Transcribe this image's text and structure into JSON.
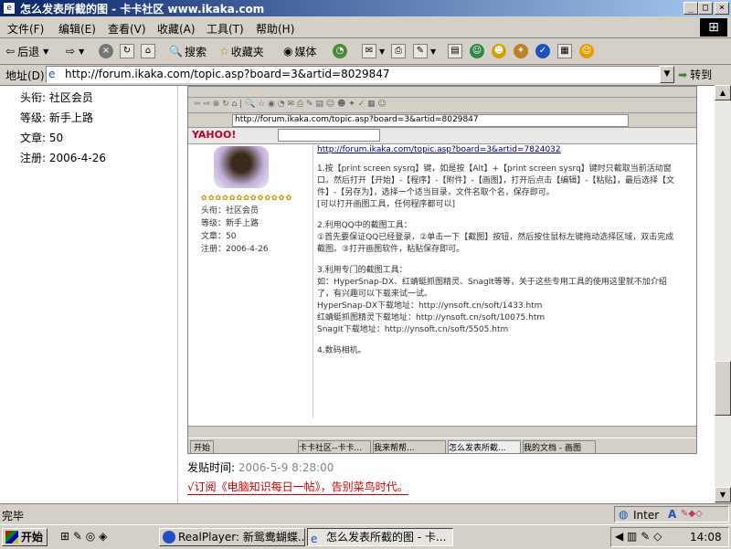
{
  "window": {
    "title": "怎么发表所截的图 - 卡卡社区 www.ikaka.com",
    "min_glyph": "_",
    "max_glyph": "□",
    "close_glyph": "×"
  },
  "menu": [
    "文件(F)",
    "编辑(E)",
    "查看(V)",
    "收藏(A)",
    "工具(T)",
    "帮助(H)"
  ],
  "toolbar": {
    "back": "后退",
    "search": "搜索",
    "favorites": "收藏夹",
    "media": "媒体"
  },
  "address": {
    "label": "地址(D)",
    "url": "http://forum.ikaka.com/topic.asp?board=3&artid=8029847",
    "go": "转到"
  },
  "user": {
    "title": "头衔: 社区会员",
    "level": "等级: 新手上路",
    "posts": "文章: 50",
    "registered": "注册: 2006-4-26"
  },
  "post": {
    "time_label": "发贴时间:",
    "time_value": "2006-5-9 8:28:00",
    "signature": "√订阅《电脑知识每日一帖》，告别菜鸟时代。"
  },
  "status": {
    "left": "完毕",
    "zone": "Inter"
  },
  "taskbar": {
    "start": "开始",
    "task1": "RealPlayer: 新鸳鸯蝴蝶...",
    "task2": "怎么发表所截的图 - 卡...",
    "clock": "14:08"
  },
  "embedded": {
    "address_url": "http://forum.ikaka.com/topic.asp?board=3&artid=8029847",
    "yahoo": "YAHOO!",
    "forum_link": "http://forum.ikaka.com/topic.asp?board=3&artid=7824032",
    "step1": "1.按【print screen sysrq】键，如是按【Alt】+【print screen sysrq】键时只截取当前活动窗口。然后打开【开始】-【程序】-【附件】-【画图】，打开后点击【编辑】-【粘贴】，最后选择【文件】-【另存为】，选择一个适当目录，文件名取个名，保存即可。",
    "step1b": "[可以打开画图工具，任何程序都可以]",
    "step2_title": "2.利用QQ中的截图工具：",
    "step2": "①首先要保证QQ已经登录，②单击一下【截图】按钮，然后按住鼠标左键拖动选择区域，双击完成截图。③打开画图软件，粘贴保存即可。",
    "step3_title": "3.利用专门的截图工具：",
    "step3": "如：HyperSnap-DX、红蜻蜓抓图精灵、SnagIt等等，关于这些专用工具的使用这里就不加介绍了，有兴趣可以下载来试一试。",
    "dl1": "HyperSnap-DX下载地址：http://ynsoft.cn/soft/1433.htm",
    "dl2": "红蜻蜓抓图精灵下载地址：http://ynsoft.cn/soft/10075.htm",
    "dl3": "SnagIt下载地址：http://ynsoft.cn/soft/5505.htm",
    "step4": "4.数码相机。",
    "sig_label1": "头衔：社区会员",
    "sig_label2": "等级：新手上路",
    "sig_label3": "文章：50",
    "sig_label4": "注册：2006-4-26",
    "start": "开始",
    "etask1": "卡卡社区--卡卡...",
    "etask2": "我来帮帮...",
    "etask3": "怎么发表所截...",
    "etask4": "我的文档 - 画图"
  }
}
